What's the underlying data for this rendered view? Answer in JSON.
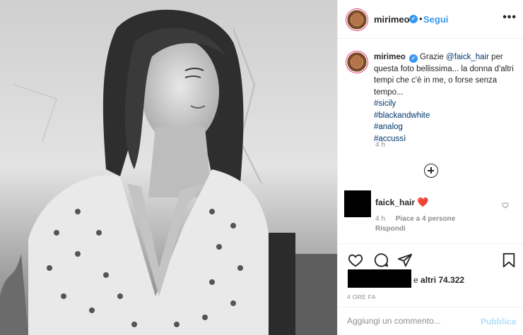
{
  "post": {
    "username": "mirimeo",
    "follow_label": "Segui",
    "dot": "•",
    "more": "•••",
    "verified_mark": "✓"
  },
  "caption": {
    "username": "mirimeo",
    "text_before": "Grazie ",
    "mention": "@faick_hair",
    "text_after": " per questa foto bellissima... la donna d'altri tempi che c'è in me, o forse senza tempo...",
    "hashtags": [
      "#sicily",
      "#blackandwhite",
      "#analog",
      "#accussì"
    ],
    "time": "4 h"
  },
  "comment": {
    "username": "faick_hair",
    "heart": "❤️",
    "time": "4 h",
    "likes": "Piace a 4 persone",
    "reply": "Rispondi"
  },
  "actions": {
    "likes_text": "altri 74.322",
    "likes_prefix": "e",
    "ago": "4 ORE FA",
    "comment_placeholder": "Aggiungi un commento...",
    "publish": "Pubblica"
  },
  "icons": {
    "heart": "heart-icon",
    "comment": "comment-icon",
    "share": "share-icon",
    "save": "bookmark-icon",
    "add": "plus-circle-icon",
    "comment_like": "heart-outline-icon"
  },
  "colors": {
    "accent": "#3897f0",
    "link": "#00376b",
    "muted": "#8e8e8e",
    "like_red": "#ed4956"
  }
}
